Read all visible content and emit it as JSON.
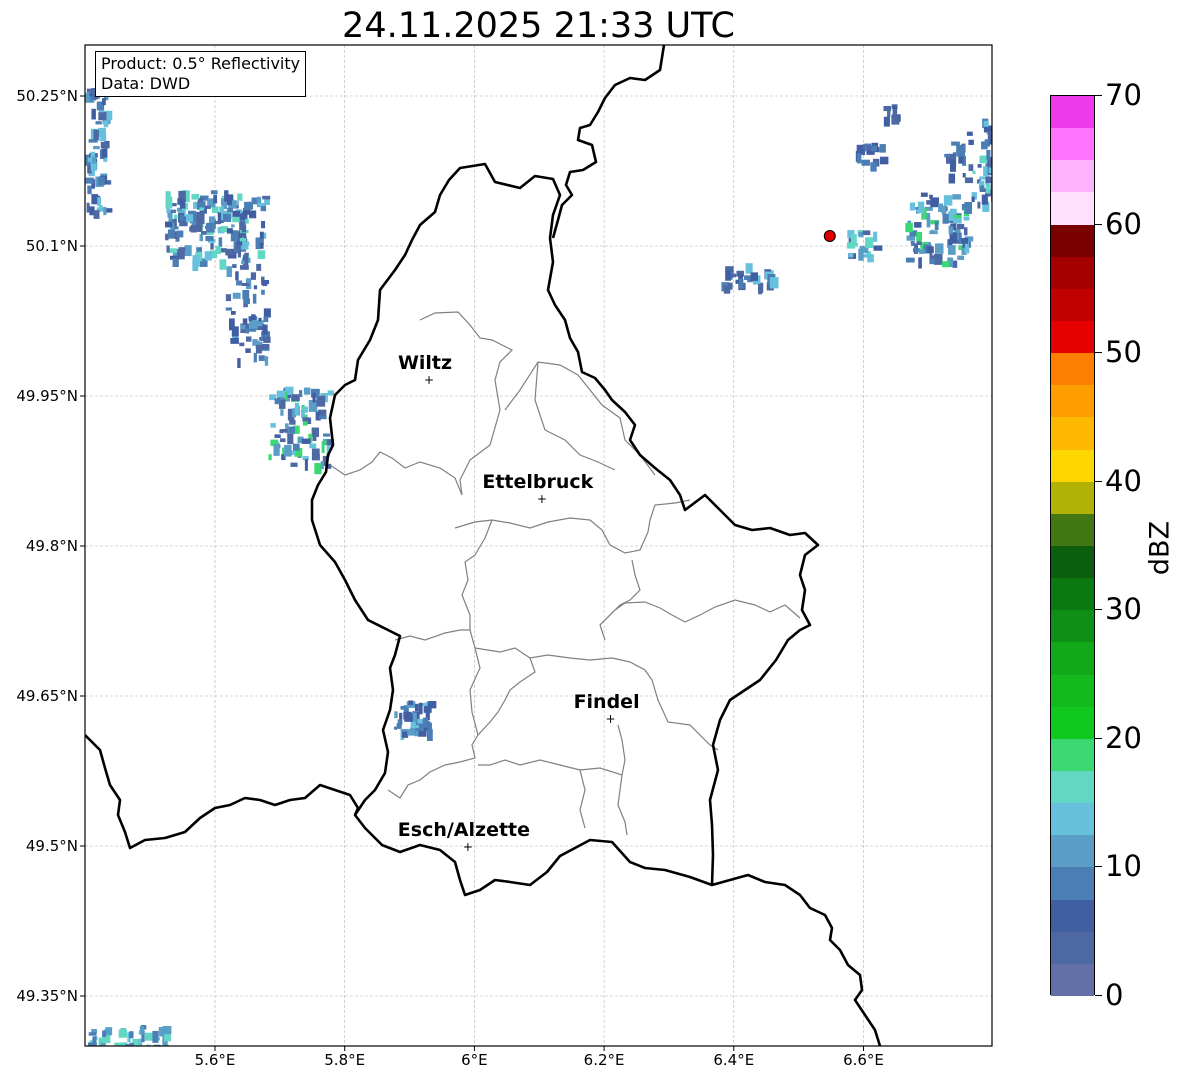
{
  "title": "24.11.2025 21:33 UTC",
  "info": {
    "product": "Product: 0.5° Reflectivity",
    "source": "Data: DWD"
  },
  "axes": {
    "x_ticks": [
      "5.6°E",
      "5.8°E",
      "6°E",
      "6.2°E",
      "6.4°E",
      "6.6°E"
    ],
    "y_ticks": [
      "50.25°N",
      "50.1°N",
      "49.95°N",
      "49.8°N",
      "49.65°N",
      "49.5°N",
      "49.35°N"
    ]
  },
  "cities": [
    {
      "name": "Wiltz",
      "lon": 5.93,
      "lat": 49.966
    },
    {
      "name": "Ettelbruck",
      "lon": 6.104,
      "lat": 49.847
    },
    {
      "name": "Findel",
      "lon": 6.21,
      "lat": 49.627
    },
    {
      "name": "Esch/Alzette",
      "lon": 5.99,
      "lat": 49.499
    }
  ],
  "radar_site": {
    "lon": 6.548,
    "lat": 50.11,
    "color": "#e00000"
  },
  "colorbar": {
    "label": "dBZ",
    "ticks": [
      "0",
      "10",
      "20",
      "30",
      "40",
      "50",
      "60",
      "70"
    ],
    "colors": [
      "#6370a8",
      "#4e68a4",
      "#405ea2",
      "#4a7eb4",
      "#5a9ec8",
      "#67c0dc",
      "#62d8c4",
      "#3cd872",
      "#11c91e",
      "#12bb1b",
      "#11a81a",
      "#0e8f15",
      "#0a7912",
      "#0a5e0e",
      "#437714",
      "#b1b205",
      "#fed700",
      "#feb800",
      "#fe9d00",
      "#fe7f00",
      "#e60000",
      "#c10000",
      "#a40000",
      "#7a0000",
      "#fee0fe",
      "#feb3fe",
      "#fe74fe",
      "#ec3aec"
    ]
  },
  "colors": {
    "country_border": "#000000",
    "district_border": "#808080",
    "grid": "#b0b0b0"
  }
}
